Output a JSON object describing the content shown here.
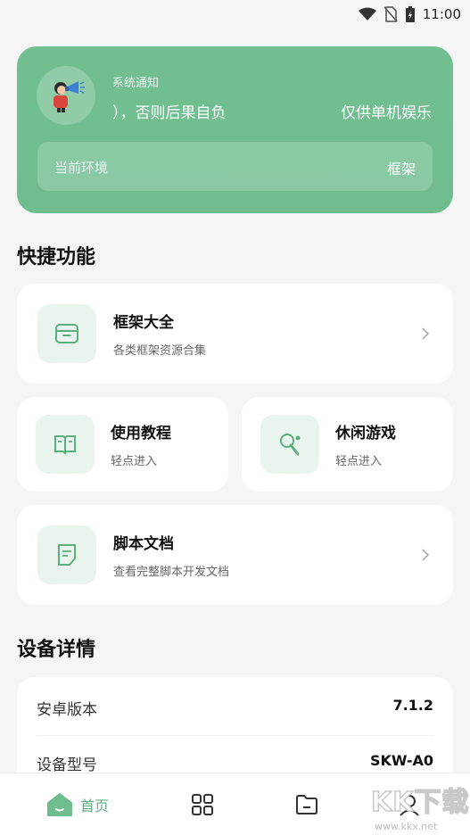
{
  "status_bar": {
    "time": "11:00"
  },
  "banner": {
    "notice_label": "系统通知",
    "notice_text_a": "），否则后果自负",
    "notice_text_b": "仅供单机娱乐",
    "env_label": "当前环境",
    "env_value": "框架"
  },
  "quick": {
    "title": "快捷功能",
    "items": [
      {
        "title": "框架大全",
        "subtitle": "各类框架资源合集"
      },
      {
        "title": "使用教程",
        "subtitle": "轻点进入"
      },
      {
        "title": "休闲游戏",
        "subtitle": "轻点进入"
      },
      {
        "title": "脚本文档",
        "subtitle": "查看完整脚本开发文档"
      }
    ]
  },
  "device": {
    "title": "设备详情",
    "rows": [
      {
        "label": "安卓版本",
        "value": "7.1.2"
      },
      {
        "label": "设备型号",
        "value": "SKW-A0"
      }
    ]
  },
  "tabbar": {
    "home_label": "首页"
  },
  "watermark": {
    "text": "KK下载",
    "url": "www.kkx.net"
  },
  "colors": {
    "accent": "#6fbc8f",
    "icon_bg": "#e9f4ee",
    "background": "#f5f5f5"
  }
}
